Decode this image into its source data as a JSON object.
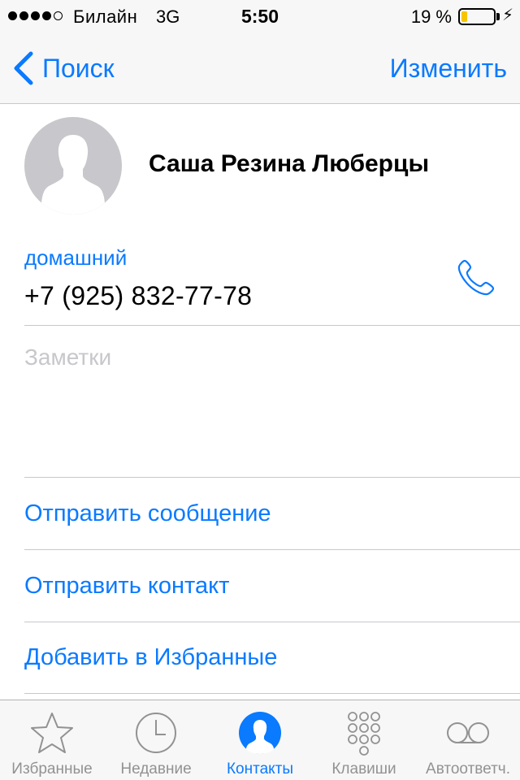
{
  "status_bar": {
    "signal_dots_filled": 4,
    "signal_dots_total": 5,
    "carrier": "Билайн",
    "network": "3G",
    "time": "5:50",
    "battery_percent": "19 %",
    "battery_level": 0.19,
    "battery_color": "#f7c500",
    "charging_icon": "lightning-icon"
  },
  "nav": {
    "back_label": "Поиск",
    "edit_label": "Изменить"
  },
  "contact": {
    "name": "Саша Резина Люберцы",
    "avatar_icon": "person-silhouette-icon",
    "phone_label": "домашний",
    "phone_number": "+7 (925) 832-77-78",
    "call_icon": "phone-icon",
    "notes_placeholder": "Заметки"
  },
  "actions": [
    {
      "label": "Отправить сообщение"
    },
    {
      "label": "Отправить контакт"
    },
    {
      "label": "Добавить в Избранные"
    }
  ],
  "tabs": [
    {
      "label": "Избранные",
      "icon": "star-icon",
      "active": false
    },
    {
      "label": "Недавние",
      "icon": "clock-icon",
      "active": false
    },
    {
      "label": "Контакты",
      "icon": "contacts-icon",
      "active": true
    },
    {
      "label": "Клавиши",
      "icon": "keypad-icon",
      "active": false
    },
    {
      "label": "Автоответч.",
      "icon": "voicemail-icon",
      "active": false
    }
  ],
  "colors": {
    "accent": "#0a7aff",
    "inactive": "#929292",
    "avatar_bg": "#c7c7cc"
  }
}
